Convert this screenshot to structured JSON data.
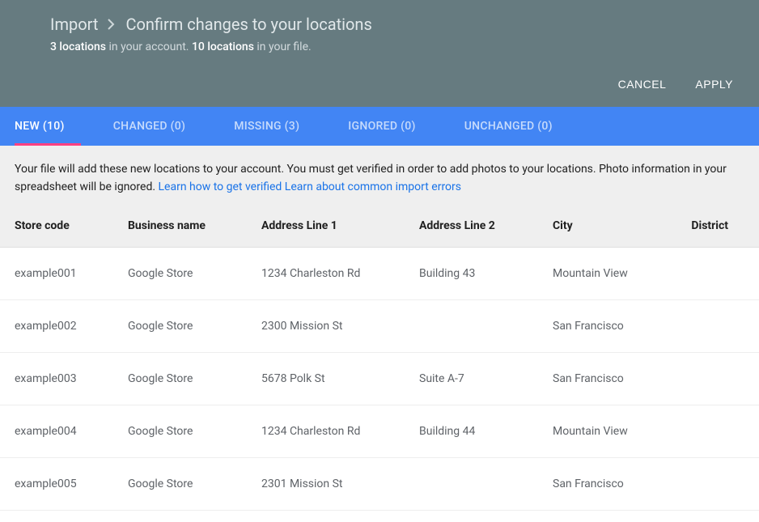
{
  "breadcrumb": {
    "parent": "Import",
    "current": "Confirm changes to your locations"
  },
  "summary": {
    "account_count": "3 locations",
    "account_suffix": " in your account. ",
    "file_count": "10 locations",
    "file_suffix": " in your file."
  },
  "actions": {
    "cancel": "CANCEL",
    "apply": "APPLY"
  },
  "tabs": [
    {
      "label": "NEW (10)",
      "active": true
    },
    {
      "label": "CHANGED (0)",
      "active": false
    },
    {
      "label": "MISSING (3)",
      "active": false
    },
    {
      "label": "IGNORED (0)",
      "active": false
    },
    {
      "label": "UNCHANGED (0)",
      "active": false
    }
  ],
  "info": {
    "text": "Your file will add these new locations to your account. You must get verified in order to add photos to your locations. Photo information in your spreadsheet will be ignored. ",
    "link1": "Learn how to get verified",
    "link2": "Learn about common import errors"
  },
  "table": {
    "headers": {
      "store_code": "Store code",
      "business_name": "Business name",
      "address1": "Address Line 1",
      "address2": "Address Line 2",
      "city": "City",
      "district": "District"
    },
    "rows": [
      {
        "store_code": "example001",
        "business_name": "Google Store",
        "address1": "1234 Charleston Rd",
        "address2": "Building 43",
        "city": "Mountain View",
        "district": ""
      },
      {
        "store_code": "example002",
        "business_name": "Google Store",
        "address1": "2300 Mission St",
        "address2": "",
        "city": "San Francisco",
        "district": ""
      },
      {
        "store_code": "example003",
        "business_name": "Google Store",
        "address1": "5678 Polk St",
        "address2": "Suite A-7",
        "city": "San Francisco",
        "district": ""
      },
      {
        "store_code": "example004",
        "business_name": "Google Store",
        "address1": "1234 Charleston Rd",
        "address2": "Building 44",
        "city": "Mountain View",
        "district": ""
      },
      {
        "store_code": "example005",
        "business_name": "Google Store",
        "address1": "2301 Mission St",
        "address2": "",
        "city": "San Francisco",
        "district": ""
      }
    ]
  }
}
